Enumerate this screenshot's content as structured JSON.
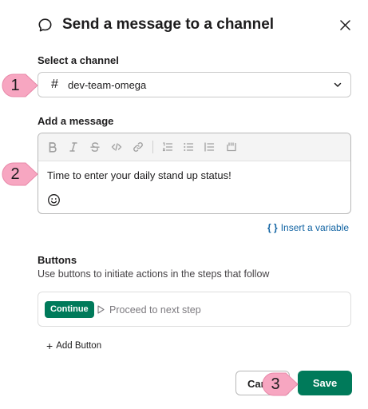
{
  "dialog": {
    "title": "Send a message to a channel",
    "title_icon": "speech-bubble-icon",
    "close_icon": "close-icon"
  },
  "channel": {
    "label": "Select a channel",
    "prefix": "#",
    "selected": "dev-team-omega"
  },
  "message": {
    "label": "Add a message",
    "toolbar": [
      "bold-icon",
      "italic-icon",
      "strikethrough-icon",
      "code-icon",
      "link-icon",
      "ordered-list-icon",
      "bulleted-list-icon",
      "indent-icon",
      "code-block-icon"
    ],
    "text": "Time to enter your daily stand up status!",
    "emoji_icon": "smiley-icon",
    "insert_variable_brace": "{ }",
    "insert_variable": "Insert a variable"
  },
  "buttons_section": {
    "label": "Buttons",
    "description": "Use buttons to initiate actions in the steps that follow",
    "items": [
      {
        "label": "Continue",
        "action": "Proceed to next step"
      }
    ],
    "add_plus": "+",
    "add_label": "Add Button"
  },
  "footer": {
    "cancel": "Cancel",
    "save": "Save"
  },
  "callouts": [
    "1",
    "2",
    "3"
  ],
  "colors": {
    "accent": "#007a5a",
    "link": "#1264a3",
    "callout": "#f7a6c1"
  }
}
